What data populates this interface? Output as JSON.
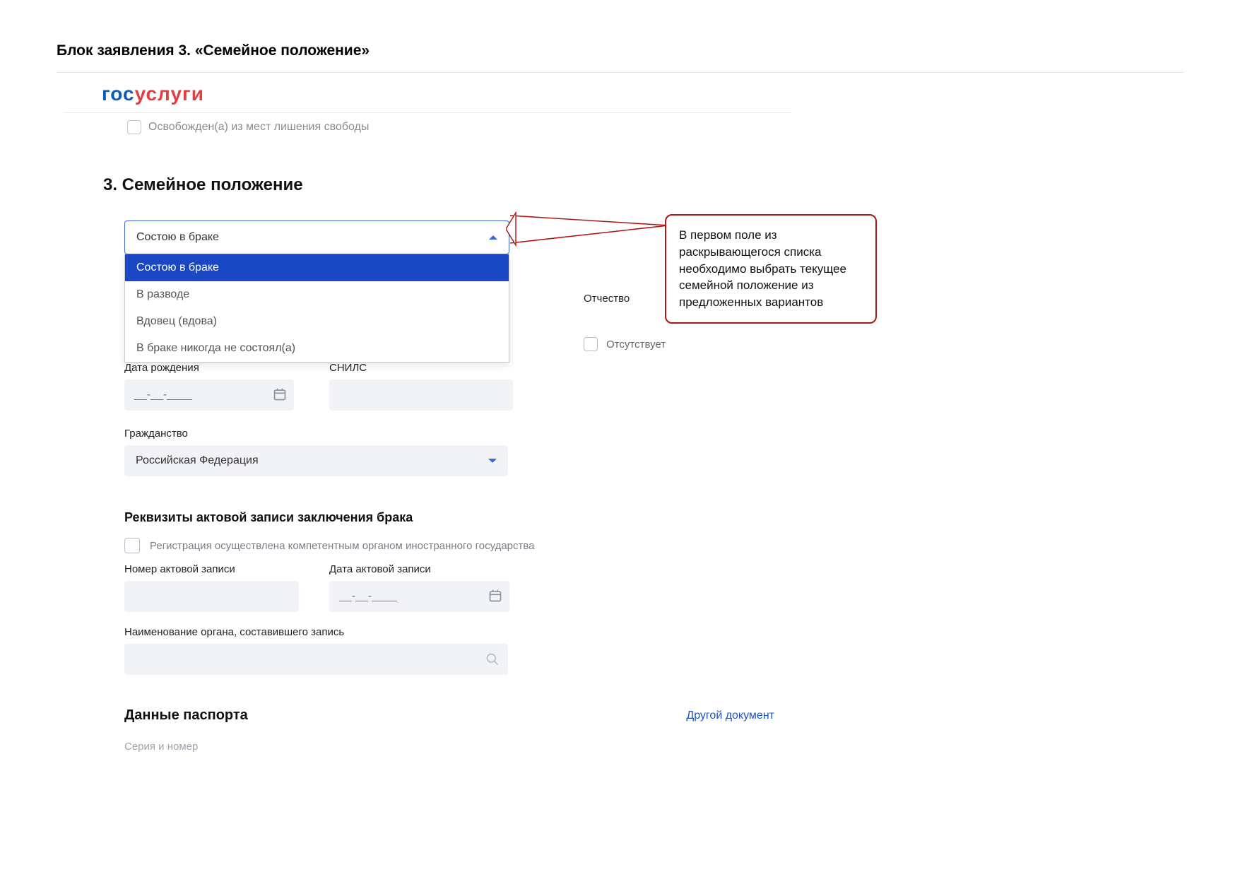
{
  "docTitle": "Блок заявления 3. «Семейное положение»",
  "logo": {
    "part1": "гос",
    "part2": "услуги"
  },
  "prevCheckbox": "Освобожден(а) из мест лишения свободы",
  "sectionTitle": "3. Семейное положение",
  "dropdown": {
    "selected": "Состою в браке",
    "options": [
      "Состою в браке",
      "В разводе",
      "Вдовец (вдова)",
      "В браке никогда не состоял(а)"
    ]
  },
  "patronymicLabel": "Отчество",
  "absentLabel": "Отсутствует",
  "dobLabel": "Дата рождения",
  "dobPlaceholder": "__-__-____",
  "snilsLabel": "СНИЛС",
  "citizenshipLabel": "Гражданство",
  "citizenshipValue": "Российская Федерация",
  "marriageRecTitle": "Реквизиты актовой записи заключения брака",
  "foreignRegCheckbox": "Регистрация осуществлена компетентным органом иностранного государства",
  "recNumLabel": "Номер актовой записи",
  "recDateLabel": "Дата актовой записи",
  "recDatePlaceholder": "__-__-____",
  "organLabel": "Наименование органа, составившего запись",
  "passportTitle": "Данные паспорта",
  "otherDocLink": "Другой документ",
  "serialLabel": "Серия и номер",
  "callout": "В первом поле из раскрывающегося списка необходимо выбрать текущее семейной положение из предложенных вариантов"
}
